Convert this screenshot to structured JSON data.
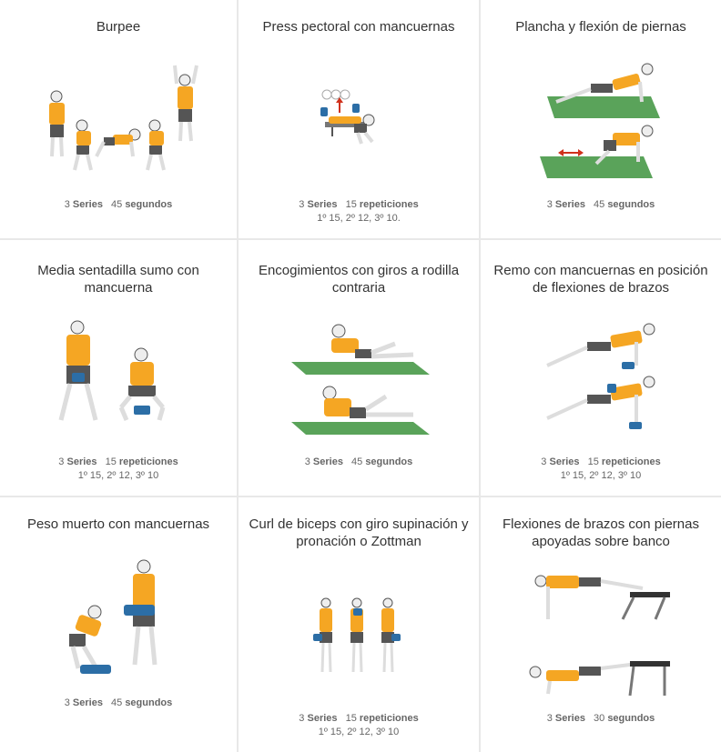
{
  "colors": {
    "shirt": "#f5a623",
    "shorts": "#555555",
    "mat": "#5aa35a",
    "dumbbell": "#2c6ea6",
    "arrow": "#d0311c",
    "border": "#e8e8e8"
  },
  "exercises": [
    {
      "title": "Burpee",
      "series_num": "3",
      "series_label": "Series",
      "value": "45",
      "unit": "segundos",
      "sub": ""
    },
    {
      "title": "Press pectoral con mancuernas",
      "series_num": "3",
      "series_label": "Series",
      "value": "15",
      "unit": "repeticiones",
      "sub": "1º 15, 2º 12, 3º 10."
    },
    {
      "title": "Plancha y flexión de piernas",
      "series_num": "3",
      "series_label": "Series",
      "value": "45",
      "unit": "segundos",
      "sub": ""
    },
    {
      "title": "Media sentadilla sumo con mancuerna",
      "series_num": "3",
      "series_label": "Series",
      "value": "15",
      "unit": "repeticiones",
      "sub": "1º 15, 2º 12, 3º 10"
    },
    {
      "title": "Encogimientos con giros a rodilla contraria",
      "series_num": "3",
      "series_label": "Series",
      "value": "45",
      "unit": "segundos",
      "sub": ""
    },
    {
      "title": "Remo con mancuernas en posición de flexiones de brazos",
      "series_num": "3",
      "series_label": "Series",
      "value": "15",
      "unit": "repeticiones",
      "sub": "1º 15, 2º 12, 3º 10"
    },
    {
      "title": "Peso muerto con mancuernas",
      "series_num": "3",
      "series_label": "Series",
      "value": "45",
      "unit": "segundos",
      "sub": ""
    },
    {
      "title": "Curl de biceps con giro supinación y pronación o Zottman",
      "series_num": "3",
      "series_label": "Series",
      "value": "15",
      "unit": "repeticiones",
      "sub": "1º 15, 2º 12, 3º 10"
    },
    {
      "title": "Flexiones de brazos con piernas apoyadas sobre banco",
      "series_num": "3",
      "series_label": "Series",
      "value": "30",
      "unit": "segundos",
      "sub": ""
    }
  ]
}
